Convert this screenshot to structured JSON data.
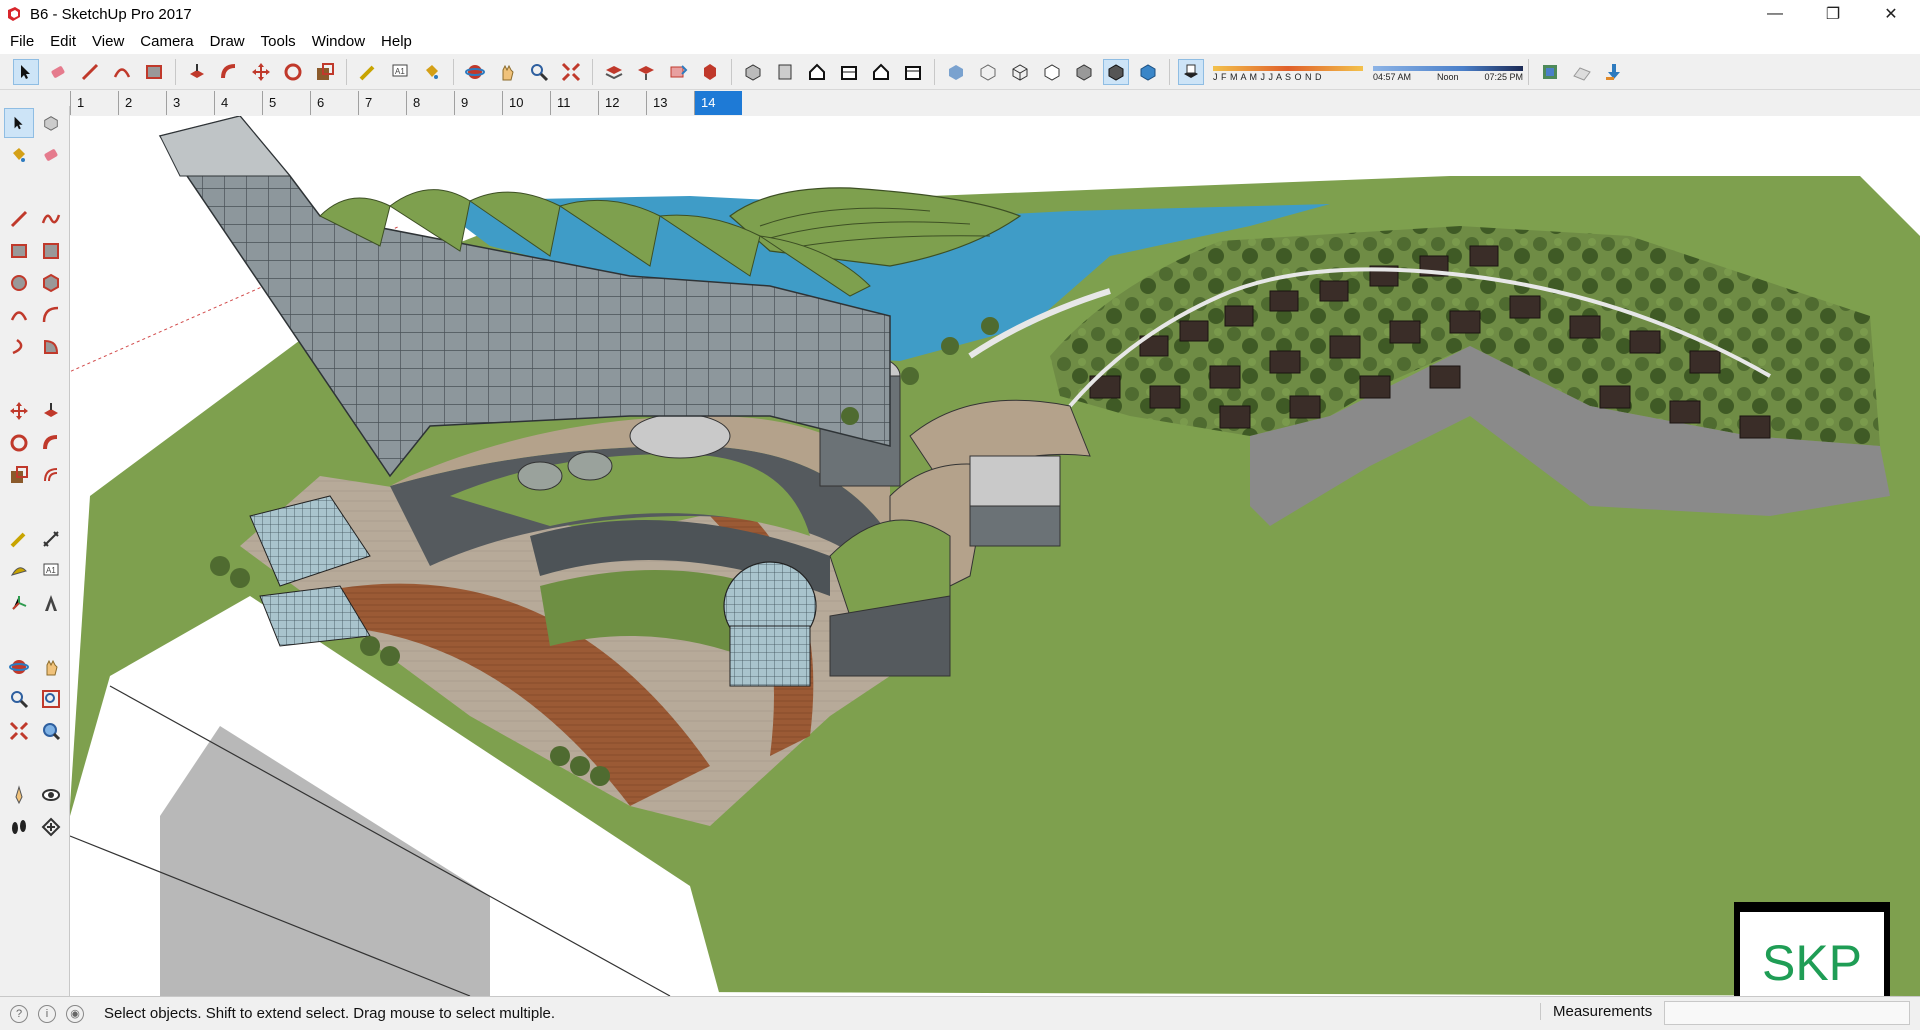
{
  "window": {
    "title": "B6 - SketchUp Pro 2017",
    "controls": {
      "minimize": "—",
      "maximize": "❐",
      "close": "✕"
    }
  },
  "menu": [
    "File",
    "Edit",
    "View",
    "Camera",
    "Draw",
    "Tools",
    "Window",
    "Help"
  ],
  "toolbar": {
    "shadow_months": "J F M A M J J A S O N D",
    "time_start": "04:57 AM",
    "time_mid": "Noon",
    "time_end": "07:25 PM"
  },
  "scenes": {
    "tabs": [
      "1",
      "2",
      "3",
      "4",
      "5",
      "6",
      "7",
      "8",
      "9",
      "10",
      "11",
      "12",
      "13",
      "14"
    ],
    "active": "14"
  },
  "watermark": "SKP",
  "status": {
    "message": "Select objects. Shift to extend select. Drag mouse to select multiple.",
    "measurements_label": "Measurements",
    "measurements_value": ""
  },
  "colors": {
    "accent": "#1e7ad6",
    "grass": "#7ea04e",
    "water": "#3f9cc7",
    "watermark_text": "#1f9d55"
  }
}
